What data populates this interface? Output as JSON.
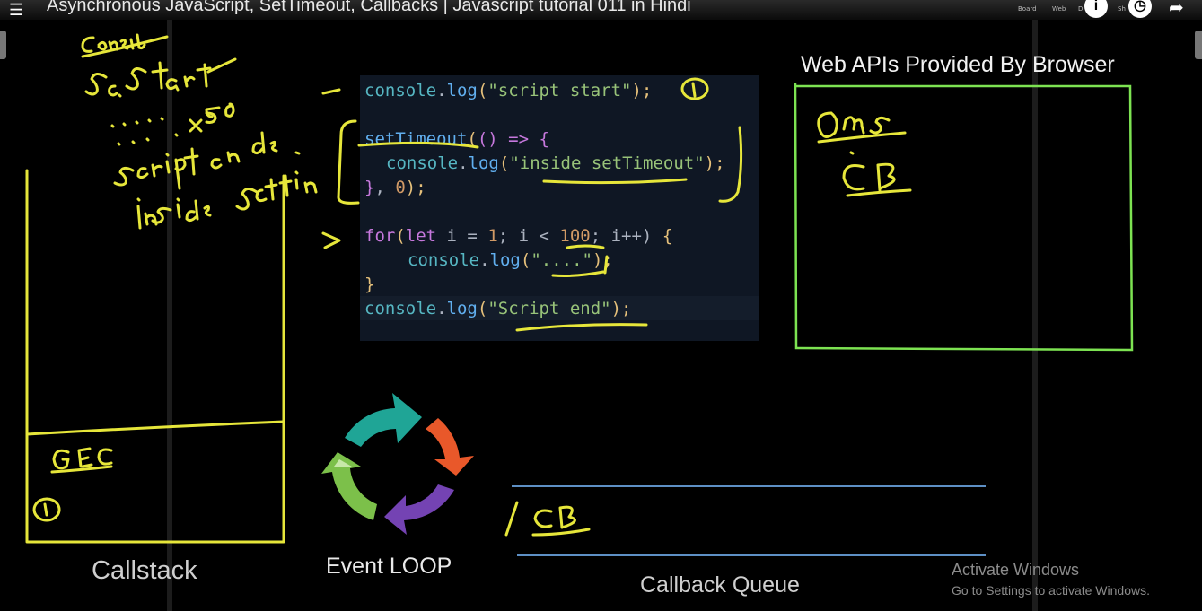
{
  "video": {
    "title": "Asynchronous JavaScript, SetTimeout, Callbacks | Javascript tutorial 011 in Hindi",
    "toolbar_items": [
      "Board",
      "Web",
      "Di",
      "Sh"
    ],
    "info_button": "i"
  },
  "code": {
    "line1": {
      "obj": "console",
      "dot": ".",
      "fn": "log",
      "open": "(",
      "str": "\"script start\"",
      "close": ");"
    },
    "line2": {
      "fn": "setTimeout",
      "open": "(",
      "args": "()",
      "arrow": " => ",
      "brace": "{"
    },
    "line3": {
      "obj": "console",
      "dot": ".",
      "fn": "log",
      "open": "(",
      "str": "\"inside setTimeout\"",
      "close": ");"
    },
    "line4": {
      "brace": "}",
      "sep": ", ",
      "num": "0",
      "close": ");"
    },
    "line5": {
      "kw1": "for",
      "open": "(",
      "kw2": "let",
      "mid": " i = ",
      "num1": "1",
      "mid2": "; i < ",
      "num2": "100",
      "mid3": "; i++) ",
      "brace": "{"
    },
    "line6": {
      "obj": "console",
      "dot": ".",
      "fn": "log",
      "open": "(",
      "str": "\"....\"",
      "close": ");"
    },
    "line7": {
      "brace": "}"
    },
    "line8": {
      "obj": "console",
      "dot": ".",
      "fn": "log",
      "open": "(",
      "str": "\"Script end\"",
      "close": ");"
    }
  },
  "labels": {
    "web_apis": "Web APIs Provided By Browser",
    "callstack": "Callstack",
    "event_loop": "Event LOOP",
    "callback_queue": "Callback Queue"
  },
  "activation": {
    "title": "Activate Windows",
    "subtitle": "Go to Settings to activate Windows."
  },
  "colors": {
    "annotation": "#e6e63a",
    "webapi_box": "#7de352",
    "queue_lines": "#5d8fc4",
    "loop_teal": "#1fa596",
    "loop_orange": "#e9582a",
    "loop_purple": "#7443b3",
    "loop_green": "#7cc04a"
  }
}
